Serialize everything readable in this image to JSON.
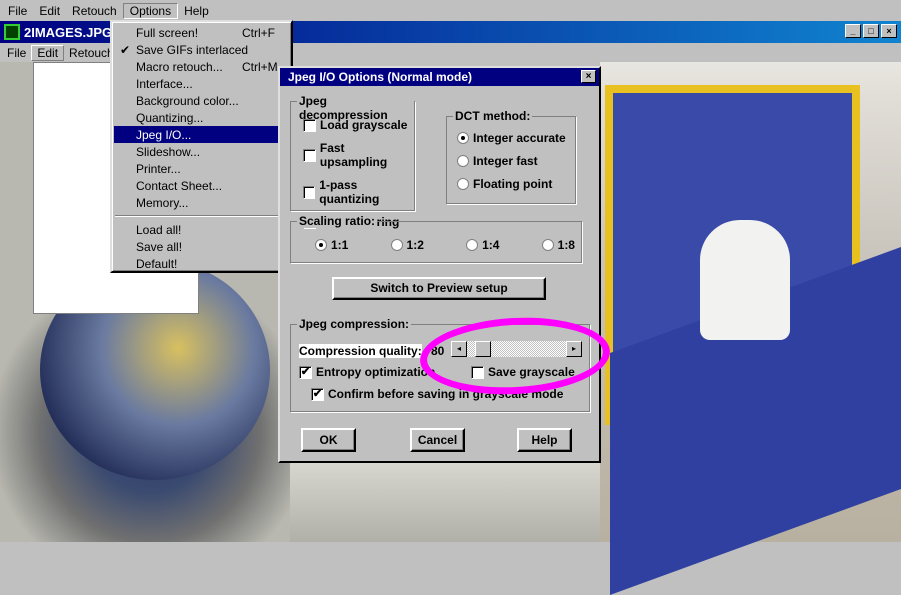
{
  "menubar": [
    "File",
    "Edit",
    "Retouch",
    "Options",
    "Help"
  ],
  "window": {
    "title": "2IMAGES.JPG:",
    "menu": [
      "File",
      "Edit",
      "Retouch"
    ],
    "buttons": [
      "_",
      "□",
      "×"
    ]
  },
  "options_menu": {
    "items": [
      {
        "label": "Full screen!",
        "shortcut": "Ctrl+F"
      },
      {
        "label": "Save GIFs interlaced",
        "checked": true
      },
      {
        "label": "Macro retouch...",
        "shortcut": "Ctrl+M"
      },
      {
        "label": "Interface..."
      },
      {
        "label": "Background color..."
      },
      {
        "label": "Quantizing..."
      },
      {
        "label": "Jpeg I/O...",
        "selected": true
      },
      {
        "label": "Slideshow..."
      },
      {
        "label": "Printer..."
      },
      {
        "label": "Contact Sheet..."
      },
      {
        "label": "Memory..."
      },
      {
        "label": "Load all!"
      },
      {
        "label": "Save all!"
      },
      {
        "label": "Default!"
      }
    ],
    "check": "✔"
  },
  "dialog": {
    "title": "Jpeg I/O Options (Normal mode)",
    "close": "×",
    "decompression": {
      "label": "Jpeg decompression",
      "options": [
        "Load grayscale",
        "Fast upsampling",
        "1-pass quantizing",
        "Fast dithering"
      ]
    },
    "dct": {
      "label": "DCT method:",
      "options": [
        "Integer accurate",
        "Integer fast",
        "Floating point"
      ],
      "selected": 0
    },
    "scaling": {
      "label": "Scaling ratio:",
      "options": [
        "1:1",
        "1:2",
        "1:4",
        "1:8"
      ],
      "selected": 0
    },
    "switch_button": "Switch to Preview setup",
    "compression": {
      "label": "Jpeg compression:",
      "quality_label": "Compression quality:",
      "quality": "80",
      "quality_fraction": 0.1,
      "entropy": "Entropy optimization",
      "save_grayscale": "Save grayscale",
      "confirm": "Confirm before saving in grayscale mode"
    },
    "ok": "OK",
    "cancel": "Cancel",
    "help": "Help",
    "checkmark": "✔",
    "left_arrow": "◂",
    "right_arrow": "▸"
  },
  "annotation_color": "#ff00ff"
}
